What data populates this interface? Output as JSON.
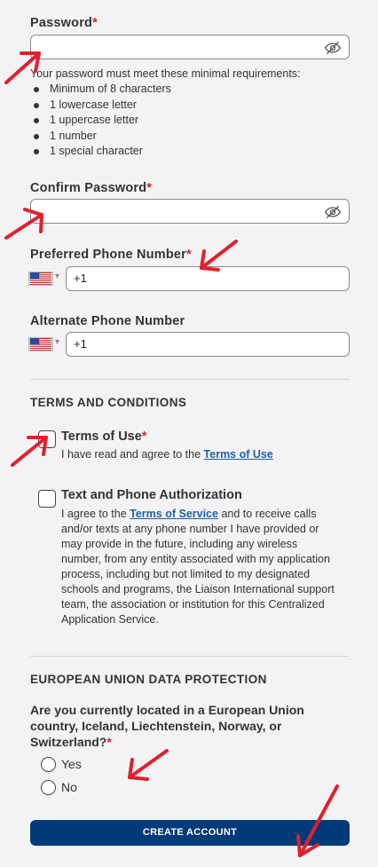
{
  "password": {
    "label": "Password",
    "required_mark": "*",
    "value": "",
    "toggle_icon": "eye-slash-icon",
    "requirements_intro": "Your password must meet these minimal requirements:",
    "requirements": [
      "Minimum of 8 characters",
      "1 lowercase letter",
      "1 uppercase letter",
      "1 number",
      "1 special character"
    ]
  },
  "confirm_password": {
    "label": "Confirm Password",
    "required_mark": "*",
    "value": "",
    "toggle_icon": "eye-slash-icon"
  },
  "preferred_phone": {
    "label": "Preferred Phone Number",
    "required_mark": "*",
    "country_flag": "us-flag-icon",
    "value": "+1"
  },
  "alternate_phone": {
    "label": "Alternate Phone Number",
    "country_flag": "us-flag-icon",
    "value": "+1"
  },
  "terms": {
    "section_title": "TERMS AND CONDITIONS",
    "terms_of_use": {
      "title": "Terms of Use",
      "required_mark": "*",
      "text_before": "I have read and agree to the ",
      "link": "Terms of Use",
      "checked": false
    },
    "text_phone_auth": {
      "title": "Text and Phone Authorization",
      "text_before": "I agree to the ",
      "link": "Terms of Service",
      "text_after": " and to receive calls and/or texts at any phone number I have provided or may provide in the future, including any wireless number, from any entity associated with my application process, including but not limited to my designated schools and programs, the Liaison International support team, the association or institution for this Centralized Application Service.",
      "checked": false
    }
  },
  "eu": {
    "section_title": "EUROPEAN UNION DATA PROTECTION",
    "question": "Are you currently located in a European Union country, Iceland, Liechtenstein, Norway, or Switzerland?",
    "required_mark": "*",
    "options": [
      "Yes",
      "No"
    ]
  },
  "submit": {
    "label": "CREATE ACCOUNT"
  },
  "colors": {
    "accent": "#003a78",
    "required": "#c42b2b",
    "link": "#1f5fa8",
    "annotation": "#e0202e"
  }
}
